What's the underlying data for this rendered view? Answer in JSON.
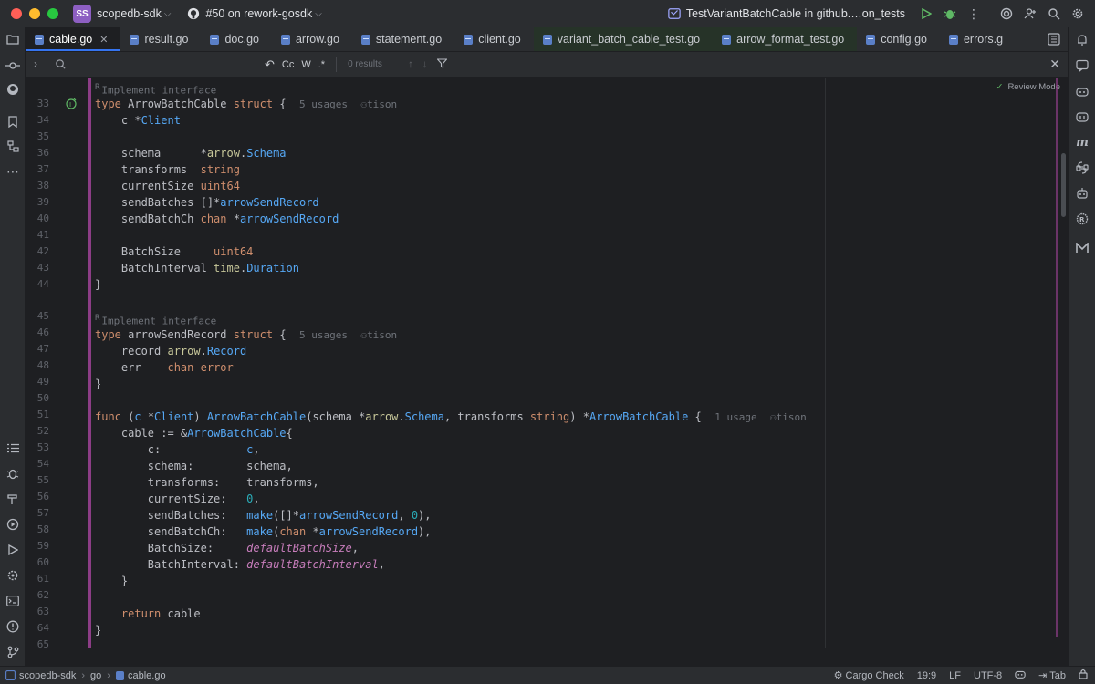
{
  "titlebar": {
    "project_badge": "SS",
    "project_name": "scopedb-sdk",
    "vcs_label": "#50 on rework-gosdk",
    "run_config": "TestVariantBatchCable in github.…on_tests"
  },
  "tabs": [
    {
      "label": "cable.go",
      "active": true
    },
    {
      "label": "result.go"
    },
    {
      "label": "doc.go"
    },
    {
      "label": "arrow.go"
    },
    {
      "label": "statement.go"
    },
    {
      "label": "client.go"
    },
    {
      "label": "variant_batch_cable_test.go",
      "tinted": true
    },
    {
      "label": "arrow_format_test.go",
      "tinted": true
    },
    {
      "label": "config.go"
    },
    {
      "label": "errors.g"
    }
  ],
  "findbar": {
    "search_value": "",
    "opt_case": "Cc",
    "opt_word": "W",
    "opt_regex": ".*",
    "results": "0 results"
  },
  "editor": {
    "review_mode": "Review Mode",
    "hint_impl": "Implement interface",
    "line_numbers": [
      "33",
      "34",
      "35",
      "36",
      "37",
      "38",
      "39",
      "40",
      "41",
      "42",
      "43",
      "44",
      "45",
      "46",
      "47",
      "48",
      "49",
      "50",
      "51",
      "52",
      "53",
      "54",
      "55",
      "56",
      "57",
      "58",
      "59",
      "60",
      "61",
      "62",
      "63",
      "64",
      "65"
    ],
    "usages_5": "5 usages",
    "usage_1": "1 usage",
    "author": "tison"
  },
  "statusbar": {
    "crumb_project": "scopedb-sdk",
    "crumb_dir": "go",
    "crumb_file": "cable.go",
    "cargo": "Cargo Check",
    "position": "19:9",
    "line_sep": "LF",
    "encoding": "UTF-8",
    "indent": "Tab"
  },
  "colors": {
    "accent": "#3574f0",
    "change_bar": "#8c3d86",
    "keyword": "#cf8e6d",
    "type": "#56a8f5"
  }
}
